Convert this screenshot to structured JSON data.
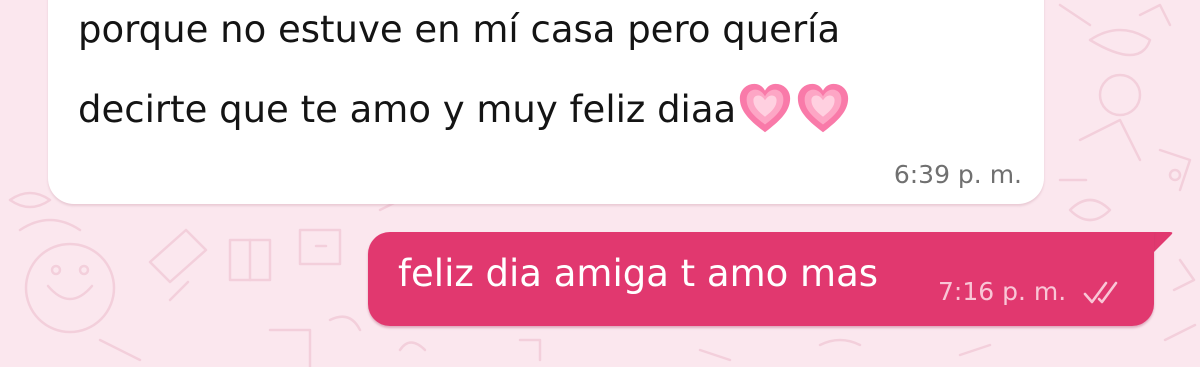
{
  "chat": {
    "incoming": {
      "line1": "porque no estuve en mí casa pero quería",
      "line2": "decirte que te amo y muy feliz diaa",
      "emoji": [
        "pink-heart-emoji",
        "pink-heart-emoji"
      ],
      "time": "6:39 p. m."
    },
    "outgoing": {
      "text": "feliz dia amiga t amo mas",
      "time": "7:16 p. m.",
      "status_icon": "double-check-icon"
    }
  },
  "colors": {
    "wallpaper": "#fbe7ee",
    "incoming_bubble": "#ffffff",
    "outgoing_bubble": "#e1386f",
    "heart": "#f774a8"
  }
}
